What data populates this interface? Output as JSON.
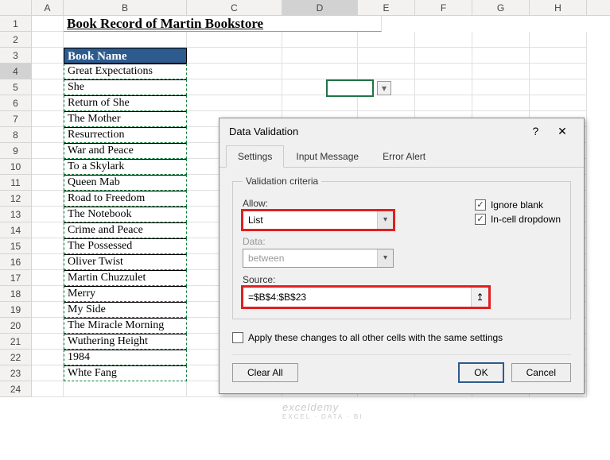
{
  "columns": [
    "A",
    "B",
    "C",
    "D",
    "E",
    "F",
    "G",
    "H"
  ],
  "selectedCol": "D",
  "selectedRow": 4,
  "title": "Book Record of Martin Bookstore",
  "tableHeader": "Book Name",
  "books": [
    "Great Expectations",
    "She",
    "Return of She",
    "The Mother",
    "Resurrection",
    "War and Peace",
    "To a Skylark",
    "Queen Mab",
    "Road to Freedom",
    "The Notebook",
    "Crime and Peace",
    "The Possessed",
    "Oliver Twist",
    "Martin Chuzzulet",
    "Merry",
    "My Side",
    "The Miracle Morning",
    "Wuthering Height",
    "1984",
    "Whte Fang"
  ],
  "dialog": {
    "title": "Data Validation",
    "help": "?",
    "close": "✕",
    "tabs": [
      "Settings",
      "Input Message",
      "Error Alert"
    ],
    "activeTab": 0,
    "legend": "Validation criteria",
    "allowLabel": "Allow:",
    "allowValue": "List",
    "dataLabel": "Data:",
    "dataValue": "between",
    "ignoreBlank": {
      "label": "Ignore blank",
      "checked": true
    },
    "inCell": {
      "label": "In-cell dropdown",
      "checked": true
    },
    "sourceLabel": "Source:",
    "sourceValue": "=$B$4:$B$23",
    "applyLabel": "Apply these changes to all other cells with the same settings",
    "applyChecked": false,
    "clearAll": "Clear All",
    "ok": "OK",
    "cancel": "Cancel"
  },
  "watermark": {
    "main": "exceldemy",
    "sub": "EXCEL · DATA · BI"
  }
}
